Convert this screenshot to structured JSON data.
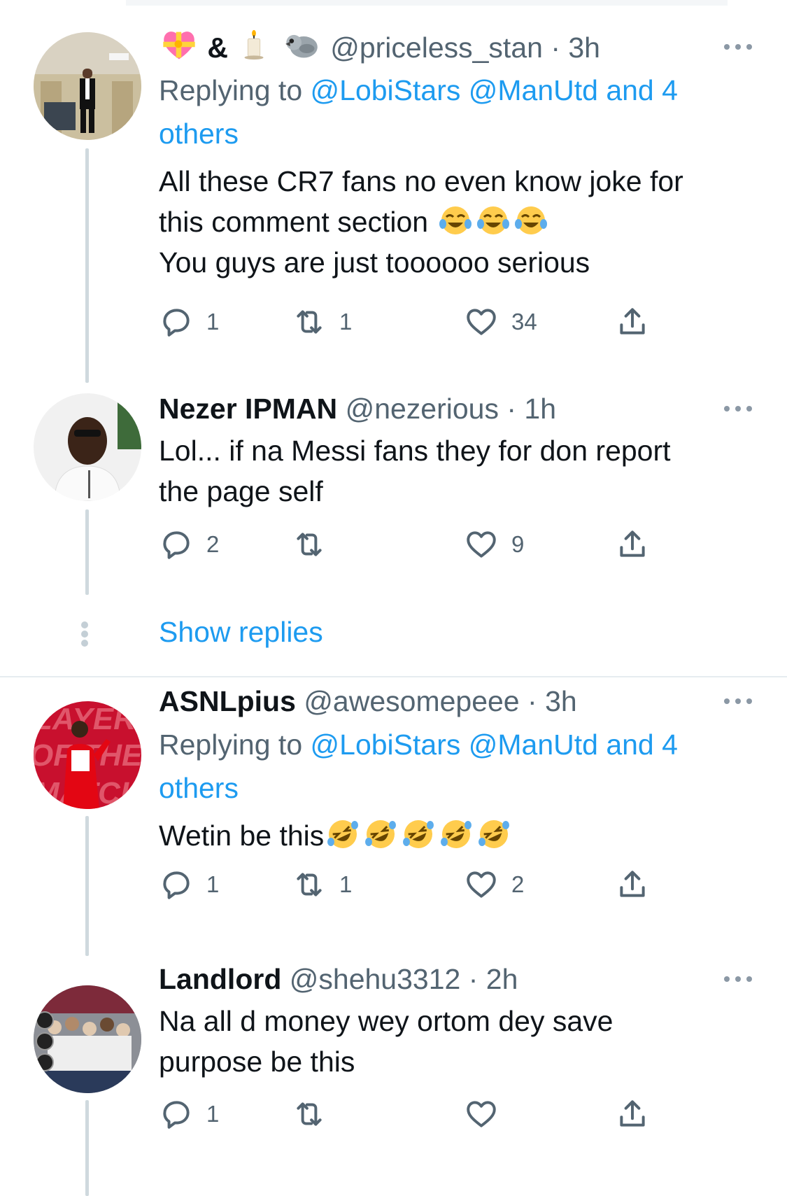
{
  "tweets": [
    {
      "name": "",
      "name_emojis": [
        "sparkling-heart-gift-icon",
        "candle-icon",
        "bird-icon"
      ],
      "ampersand": "&",
      "handle": "@priceless_stan",
      "dot": "·",
      "time": "3h",
      "replying_prefix": "Replying to",
      "replying_links": "@LobiStars @ManUtd and 4 others",
      "text_line1": "All these CR7 fans no even know joke for",
      "text_line2": "this comment section",
      "text_line3": "You guys are just toooooo serious",
      "text_emojis": [
        "joy-icon",
        "joy-icon",
        "joy-icon"
      ],
      "replies": "1",
      "retweets": "1",
      "likes": "34"
    },
    {
      "name": "Nezer IPMAN",
      "handle": "@nezerious",
      "dot": "·",
      "time": "1h",
      "text_line1": "Lol... if na Messi fans they for don report",
      "text_line2": "the page self",
      "replies": "2",
      "retweets": "",
      "likes": "9"
    },
    {
      "name": "ASNLpius",
      "handle": "@awesomepeee",
      "dot": "·",
      "time": "3h",
      "replying_prefix": "Replying to",
      "replying_links": "@LobiStars @ManUtd and 4 others",
      "text_line1": "Wetin be this",
      "text_emojis": [
        "rofl-icon",
        "rofl-icon",
        "rofl-icon",
        "rofl-icon",
        "rofl-icon"
      ],
      "replies": "1",
      "retweets": "1",
      "likes": "2"
    },
    {
      "name": "Landlord",
      "handle": "@shehu3312",
      "dot": "·",
      "time": "2h",
      "text_line1": "Na all d money wey ortom dey save",
      "text_line2": "purpose be this",
      "replies": "1",
      "retweets": "",
      "likes": ""
    }
  ],
  "show_replies_label": "Show replies",
  "replying_split": {
    "line1": "@LobiStars @ManUtd and 4",
    "line2": "others"
  },
  "colors": {
    "link": "#1d9bf0",
    "secondary_text": "#536471",
    "primary_text": "#0f1419",
    "thread_line": "#cfd9de",
    "divider": "#e6ecf0"
  }
}
